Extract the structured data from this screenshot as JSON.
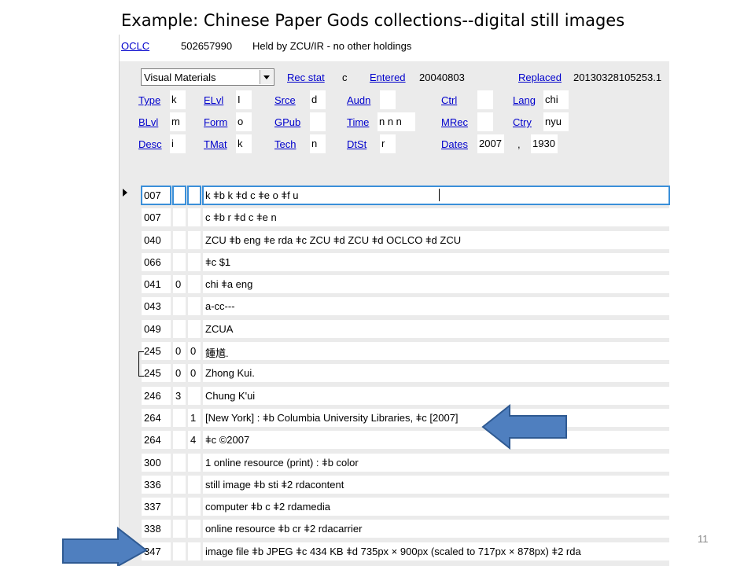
{
  "slide": {
    "title": "Example: Chinese Paper Gods collections--digital still images",
    "page_number": "11"
  },
  "header": {
    "oclc_label": "OCLC",
    "oclc_number": "502657990",
    "holdings": "Held by ZCU/IR - no other holdings"
  },
  "fixed": {
    "format_select": "Visual Materials",
    "rec_stat": {
      "label": "Rec stat",
      "value": "c"
    },
    "entered": {
      "label": "Entered",
      "value": "20040803"
    },
    "replaced": {
      "label": "Replaced",
      "value": "20130328105253.1"
    },
    "row1": [
      {
        "label": "Type",
        "value": "k"
      },
      {
        "label": "ELvl",
        "value": "I"
      },
      {
        "label": "Srce",
        "value": "d"
      },
      {
        "label": "Audn",
        "value": ""
      },
      {
        "label": "Ctrl",
        "value": ""
      },
      {
        "label": "Lang",
        "value": "chi"
      }
    ],
    "row2": [
      {
        "label": "BLvl",
        "value": "m"
      },
      {
        "label": "Form",
        "value": "o"
      },
      {
        "label": "GPub",
        "value": ""
      },
      {
        "label": "Time",
        "value": "n n n"
      },
      {
        "label": "MRec",
        "value": ""
      },
      {
        "label": "Ctry",
        "value": "nyu"
      }
    ],
    "row3": [
      {
        "label": "Desc",
        "value": "i"
      },
      {
        "label": "TMat",
        "value": "k"
      },
      {
        "label": "Tech",
        "value": "n"
      },
      {
        "label": "DtSt",
        "value": "r"
      },
      {
        "label": "Dates",
        "value": "2007"
      },
      {
        "label": "",
        "value": ","
      },
      {
        "label": "",
        "value": "1930"
      }
    ]
  },
  "fields": [
    {
      "tag": "007",
      "i1": "",
      "i2": "",
      "data": "k ǂb k ǂd c ǂe o ǂf u"
    },
    {
      "tag": "007",
      "i1": "",
      "i2": "",
      "data": "c ǂb r ǂd c ǂe n"
    },
    {
      "tag": "040",
      "i1": "",
      "i2": "",
      "data": "ZCU ǂb eng ǂe rda ǂc ZCU ǂd ZCU ǂd OCLCO ǂd ZCU"
    },
    {
      "tag": "066",
      "i1": "",
      "i2": "",
      "data": "ǂc $1"
    },
    {
      "tag": "041",
      "i1": "0",
      "i2": "",
      "data": "chi ǂa eng"
    },
    {
      "tag": "043",
      "i1": "",
      "i2": "",
      "data": "a-cc---"
    },
    {
      "tag": "049",
      "i1": "",
      "i2": "",
      "data": "ZCUA"
    },
    {
      "tag": "245",
      "i1": "0",
      "i2": "0",
      "data": "鍾馗."
    },
    {
      "tag": "245",
      "i1": "0",
      "i2": "0",
      "data": "Zhong Kui."
    },
    {
      "tag": "246",
      "i1": "3",
      "i2": "",
      "data": "Chung K'ui"
    },
    {
      "tag": "264",
      "i1": "",
      "i2": "1",
      "data": "[New York] : ǂb Columbia University Libraries, ǂc [2007]"
    },
    {
      "tag": "264",
      "i1": "",
      "i2": "4",
      "data": "ǂc ©2007"
    },
    {
      "tag": "300",
      "i1": "",
      "i2": "",
      "data": "1 online resource (print) : ǂb color"
    },
    {
      "tag": "336",
      "i1": "",
      "i2": "",
      "data": "still image ǂb sti ǂ2 rdacontent"
    },
    {
      "tag": "337",
      "i1": "",
      "i2": "",
      "data": "computer ǂb c ǂ2 rdamedia"
    },
    {
      "tag": "338",
      "i1": "",
      "i2": "",
      "data": "online resource ǂb cr ǂ2 rdacarrier"
    },
    {
      "tag": "347",
      "i1": "",
      "i2": "",
      "data": "image file ǂb JPEG ǂc 434 KB ǂd 735px × 900px (scaled to 717px × 878px) ǂ2 rda"
    }
  ],
  "colors": {
    "arrow_fill": "#4f7fbf",
    "arrow_stroke": "#2f5a92",
    "active_outline": "#3a8fd9"
  }
}
